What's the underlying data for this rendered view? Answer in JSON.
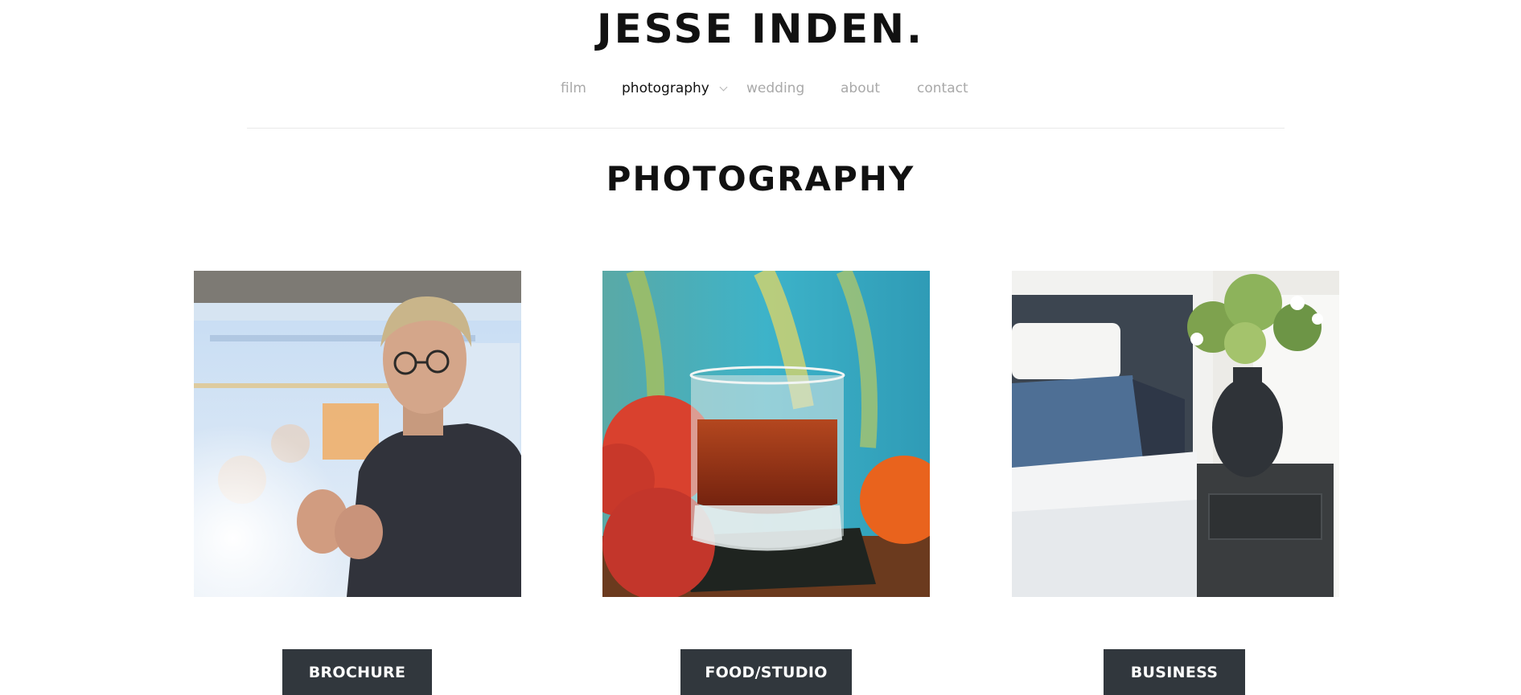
{
  "site": {
    "title": "JESSE INDEN."
  },
  "nav": {
    "items": [
      {
        "label": "film"
      },
      {
        "label": "photography",
        "active": true,
        "has_dropdown": true
      },
      {
        "label": "wedding"
      },
      {
        "label": "about"
      },
      {
        "label": "contact"
      }
    ],
    "dropdown_icon": "chevron-down-icon"
  },
  "main": {
    "heading": "PHOTOGRAPHY",
    "cards": [
      {
        "label": "BROCHURE",
        "image": "speaker-portrait-photo"
      },
      {
        "label": "FOOD/STUDIO",
        "image": "drink-with-fruit-photo"
      },
      {
        "label": "BUSINESS",
        "image": "bedroom-interior-photo"
      }
    ]
  },
  "colors": {
    "text": "#111111",
    "nav_inactive": "#a9a9a9",
    "button_bg": "#31373d",
    "button_text": "#ffffff",
    "divider": "#e9e9e9"
  }
}
